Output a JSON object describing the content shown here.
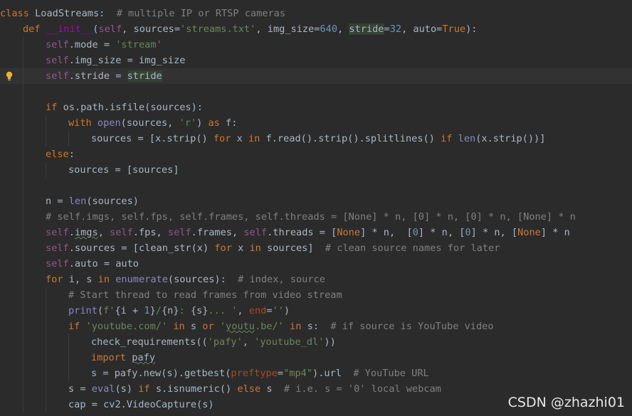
{
  "editor": {
    "language": "python",
    "current_line_index": 4,
    "colors": {
      "background": "#2b2b2b",
      "current_line": "#323232",
      "keyword": "#cc7832",
      "self": "#94558d",
      "string": "#6a8759",
      "number": "#6897bb",
      "comment": "#808080",
      "dunder": "#b200b2",
      "builtin": "#8888c6",
      "kwarg": "#aa4926",
      "text": "#a9b7c6"
    },
    "gutter_icon": "lightbulb-icon",
    "lines": [
      {
        "indent": 0,
        "tokens": [
          {
            "t": "class",
            "c": "kw"
          },
          {
            "t": " LoadStreams:  ",
            "c": "plain"
          },
          {
            "t": "# multiple IP or RTSP cameras",
            "c": "cmt"
          }
        ]
      },
      {
        "indent": 1,
        "tokens": [
          {
            "t": "def ",
            "c": "kw"
          },
          {
            "t": "__init__",
            "c": "fn"
          },
          {
            "t": "(",
            "c": "plain"
          },
          {
            "t": "self",
            "c": "self"
          },
          {
            "t": ", sources=",
            "c": "plain"
          },
          {
            "t": "'streams.txt'",
            "c": "str"
          },
          {
            "t": ", img_size=",
            "c": "plain"
          },
          {
            "t": "640",
            "c": "num"
          },
          {
            "t": ", ",
            "c": "plain"
          },
          {
            "t": "stride",
            "c": "plain",
            "hl": true
          },
          {
            "t": "=",
            "c": "plain"
          },
          {
            "t": "32",
            "c": "num"
          },
          {
            "t": ", auto=",
            "c": "plain"
          },
          {
            "t": "True",
            "c": "kw"
          },
          {
            "t": "):",
            "c": "plain"
          }
        ]
      },
      {
        "indent": 2,
        "tokens": [
          {
            "t": "self",
            "c": "self"
          },
          {
            "t": ".mode = ",
            "c": "plain"
          },
          {
            "t": "'stream'",
            "c": "str"
          }
        ]
      },
      {
        "indent": 2,
        "tokens": [
          {
            "t": "self",
            "c": "self"
          },
          {
            "t": ".img_size = img_size",
            "c": "plain"
          }
        ]
      },
      {
        "indent": 2,
        "tokens": [
          {
            "t": "self",
            "c": "self"
          },
          {
            "t": ".stride = ",
            "c": "plain"
          },
          {
            "t": "stride",
            "c": "plain",
            "hl": true
          }
        ]
      },
      {
        "indent": 2,
        "tokens": []
      },
      {
        "indent": 2,
        "tokens": [
          {
            "t": "if ",
            "c": "kw"
          },
          {
            "t": "os.path.isfile(sources):",
            "c": "plain"
          }
        ]
      },
      {
        "indent": 3,
        "tokens": [
          {
            "t": "with ",
            "c": "kw"
          },
          {
            "t": "open",
            "c": "builtin"
          },
          {
            "t": "(sources, ",
            "c": "plain"
          },
          {
            "t": "'r'",
            "c": "str"
          },
          {
            "t": ") ",
            "c": "plain"
          },
          {
            "t": "as ",
            "c": "kw"
          },
          {
            "t": "f:",
            "c": "plain"
          }
        ]
      },
      {
        "indent": 4,
        "tokens": [
          {
            "t": "sources = [x.strip() ",
            "c": "plain"
          },
          {
            "t": "for ",
            "c": "kw"
          },
          {
            "t": "x ",
            "c": "plain"
          },
          {
            "t": "in ",
            "c": "kw"
          },
          {
            "t": "f.read().strip().splitlines() ",
            "c": "plain"
          },
          {
            "t": "if ",
            "c": "kw"
          },
          {
            "t": "len",
            "c": "builtin"
          },
          {
            "t": "(x.strip())]",
            "c": "plain"
          }
        ]
      },
      {
        "indent": 2,
        "tokens": [
          {
            "t": "else",
            "c": "kw"
          },
          {
            "t": ":",
            "c": "plain"
          }
        ]
      },
      {
        "indent": 3,
        "tokens": [
          {
            "t": "sources = [sources]",
            "c": "plain"
          }
        ]
      },
      {
        "indent": 2,
        "tokens": []
      },
      {
        "indent": 2,
        "tokens": [
          {
            "t": "n = ",
            "c": "plain"
          },
          {
            "t": "len",
            "c": "builtin"
          },
          {
            "t": "(sources)",
            "c": "plain"
          }
        ]
      },
      {
        "indent": 2,
        "tokens": [
          {
            "t": "# self.imgs, self.fps, self.frames, self.threads = [None] * n, [0] * n, [0] * n, [None] * n",
            "c": "cmt"
          }
        ]
      },
      {
        "indent": 2,
        "tokens": [
          {
            "t": "self",
            "c": "self"
          },
          {
            "t": ".",
            "c": "plain"
          },
          {
            "t": "imgs",
            "c": "plain",
            "typo": true
          },
          {
            "t": ", ",
            "c": "plain"
          },
          {
            "t": "self",
            "c": "self"
          },
          {
            "t": ".fps, ",
            "c": "plain"
          },
          {
            "t": "self",
            "c": "self"
          },
          {
            "t": ".frames, ",
            "c": "plain"
          },
          {
            "t": "self",
            "c": "self"
          },
          {
            "t": ".threads = [",
            "c": "plain"
          },
          {
            "t": "None",
            "c": "kw"
          },
          {
            "t": "] * n,  [",
            "c": "plain"
          },
          {
            "t": "0",
            "c": "num"
          },
          {
            "t": "] * n, [",
            "c": "plain"
          },
          {
            "t": "0",
            "c": "num"
          },
          {
            "t": "] * n, [",
            "c": "plain"
          },
          {
            "t": "None",
            "c": "kw"
          },
          {
            "t": "] * n",
            "c": "plain"
          }
        ]
      },
      {
        "indent": 2,
        "tokens": [
          {
            "t": "self",
            "c": "self"
          },
          {
            "t": ".sources = [clean_str(x) ",
            "c": "plain"
          },
          {
            "t": "for ",
            "c": "kw"
          },
          {
            "t": "x ",
            "c": "plain"
          },
          {
            "t": "in ",
            "c": "kw"
          },
          {
            "t": "sources]  ",
            "c": "plain"
          },
          {
            "t": "# clean source names for later",
            "c": "cmt"
          }
        ]
      },
      {
        "indent": 2,
        "tokens": [
          {
            "t": "self",
            "c": "self"
          },
          {
            "t": ".auto = auto",
            "c": "plain"
          }
        ]
      },
      {
        "indent": 2,
        "tokens": [
          {
            "t": "for ",
            "c": "kw"
          },
          {
            "t": "i, s ",
            "c": "plain"
          },
          {
            "t": "in ",
            "c": "kw"
          },
          {
            "t": "enumerate",
            "c": "builtin"
          },
          {
            "t": "(sources):  ",
            "c": "plain"
          },
          {
            "t": "# index, source",
            "c": "cmt"
          }
        ]
      },
      {
        "indent": 3,
        "tokens": [
          {
            "t": "# Start thread to read frames from video stream",
            "c": "cmt"
          }
        ]
      },
      {
        "indent": 3,
        "tokens": [
          {
            "t": "print",
            "c": "builtin"
          },
          {
            "t": "(",
            "c": "plain"
          },
          {
            "t": "f'",
            "c": "str"
          },
          {
            "t": "{i + ",
            "c": "plain"
          },
          {
            "t": "1",
            "c": "num"
          },
          {
            "t": "}",
            "c": "plain"
          },
          {
            "t": "/",
            "c": "str"
          },
          {
            "t": "{n}",
            "c": "plain"
          },
          {
            "t": ": ",
            "c": "str"
          },
          {
            "t": "{s}",
            "c": "plain"
          },
          {
            "t": "... '",
            "c": "str"
          },
          {
            "t": ", ",
            "c": "plain"
          },
          {
            "t": "end",
            "c": "kwarg"
          },
          {
            "t": "=",
            "c": "plain"
          },
          {
            "t": "''",
            "c": "str"
          },
          {
            "t": ")",
            "c": "plain"
          }
        ]
      },
      {
        "indent": 3,
        "tokens": [
          {
            "t": "if ",
            "c": "kw"
          },
          {
            "t": "'youtube.com/' ",
            "c": "str"
          },
          {
            "t": "in ",
            "c": "kw"
          },
          {
            "t": "s ",
            "c": "plain"
          },
          {
            "t": "or ",
            "c": "kw"
          },
          {
            "t": "'",
            "c": "str"
          },
          {
            "t": "youtu",
            "c": "str",
            "typo": true
          },
          {
            "t": ".be/' ",
            "c": "str"
          },
          {
            "t": "in ",
            "c": "kw"
          },
          {
            "t": "s:  ",
            "c": "plain"
          },
          {
            "t": "# if source is YouTube video",
            "c": "cmt"
          }
        ]
      },
      {
        "indent": 4,
        "tokens": [
          {
            "t": "check_requirements((",
            "c": "plain"
          },
          {
            "t": "'pafy'",
            "c": "str"
          },
          {
            "t": ", ",
            "c": "plain"
          },
          {
            "t": "'youtube_dl'",
            "c": "str"
          },
          {
            "t": "))",
            "c": "plain"
          }
        ]
      },
      {
        "indent": 4,
        "tokens": [
          {
            "t": "import ",
            "c": "kw"
          },
          {
            "t": "pafy",
            "c": "plain",
            "typo": true
          }
        ]
      },
      {
        "indent": 4,
        "tokens": [
          {
            "t": "s = pafy.new(s).getbest(",
            "c": "plain"
          },
          {
            "t": "preftype",
            "c": "kwarg"
          },
          {
            "t": "=",
            "c": "plain"
          },
          {
            "t": "\"mp4\"",
            "c": "str"
          },
          {
            "t": ").url  ",
            "c": "plain"
          },
          {
            "t": "# YouTube URL",
            "c": "cmt"
          }
        ]
      },
      {
        "indent": 3,
        "tokens": [
          {
            "t": "s = ",
            "c": "plain"
          },
          {
            "t": "eval",
            "c": "builtin"
          },
          {
            "t": "(s) ",
            "c": "plain"
          },
          {
            "t": "if ",
            "c": "kw"
          },
          {
            "t": "s.isnumeric() ",
            "c": "plain"
          },
          {
            "t": "else ",
            "c": "kw"
          },
          {
            "t": "s  ",
            "c": "plain"
          },
          {
            "t": "# i.e. s = '0' local webcam",
            "c": "cmt"
          }
        ]
      },
      {
        "indent": 3,
        "tokens": [
          {
            "t": "cap = cv2.VideoCapture(s)",
            "c": "plain"
          }
        ]
      }
    ]
  },
  "watermark": {
    "text": "CSDN @zhazhi01"
  }
}
